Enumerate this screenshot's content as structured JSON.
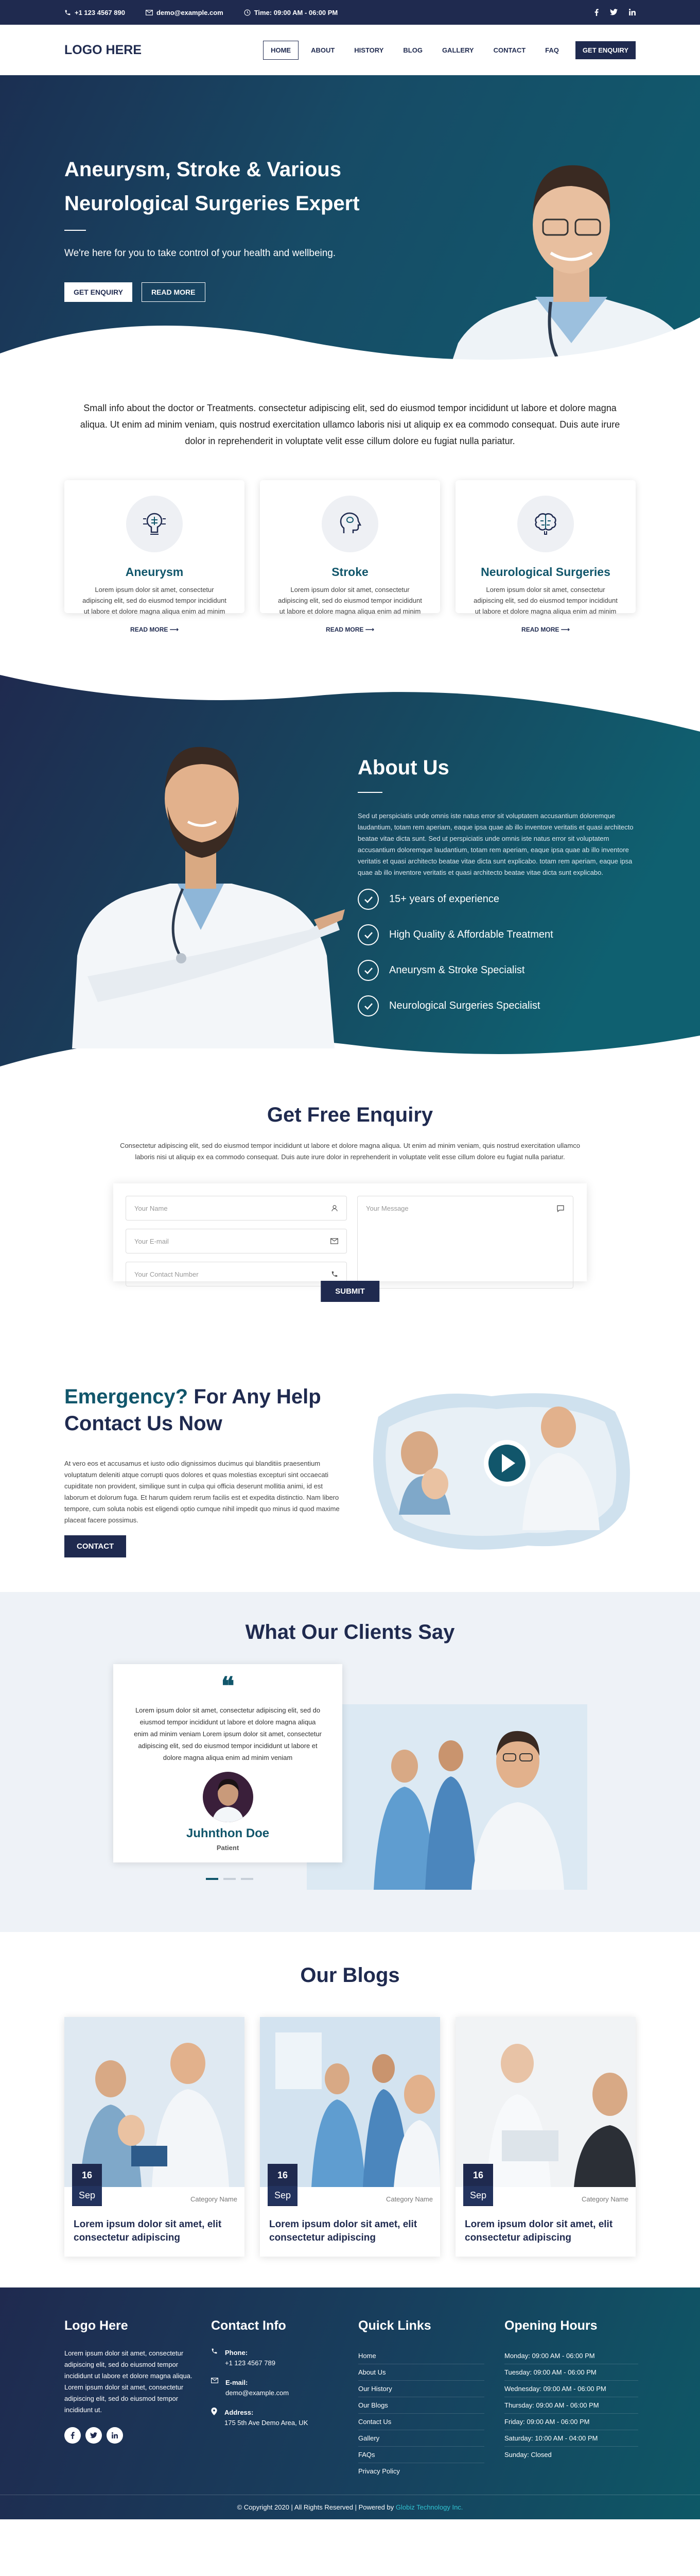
{
  "topbar": {
    "phone": "+1 123 4567 890",
    "email": "demo@example.com",
    "time": "Time: 09:00 AM - 06:00 PM"
  },
  "nav": {
    "logo": "LOGO HERE",
    "items": [
      "HOME",
      "ABOUT",
      "HISTORY",
      "BLOG",
      "GALLERY",
      "CONTACT",
      "FAQ"
    ],
    "cta": "GET ENQUIRY"
  },
  "hero": {
    "title": "Aneurysm, Stroke & Various Neurological Surgeries Expert",
    "subtitle": "We're here for you to take control of your health and wellbeing.",
    "btn_primary": "GET ENQUIRY",
    "btn_secondary": "READ MORE"
  },
  "intro": "Small info about the doctor or Treatments. consectetur adipiscing elit, sed do eiusmod tempor incididunt ut labore et dolore magna aliqua. Ut enim ad minim veniam, quis nostrud exercitation ullamco laboris nisi ut aliquip ex ea commodo consequat. Duis aute irure dolor in reprehenderit in voluptate velit esse cillum dolore eu fugiat nulla pariatur.",
  "services": [
    {
      "title": "Aneurysm",
      "desc": "Lorem ipsum dolor sit amet, consectetur adipiscing elit, sed do eiusmod tempor incididunt ut labore et dolore magna aliqua enim ad minim",
      "more": "READ MORE",
      "icon": "brain-circuit-icon"
    },
    {
      "title": "Stroke",
      "desc": "Lorem ipsum dolor sit amet, consectetur adipiscing elit, sed do eiusmod tempor incididunt ut labore et dolore magna aliqua enim ad minim",
      "more": "READ MORE",
      "icon": "head-brain-icon"
    },
    {
      "title": "Neurological Surgeries",
      "desc": "Lorem ipsum dolor sit amet, consectetur adipiscing elit, sed do eiusmod tempor incididunt ut labore et dolore magna aliqua enim ad minim",
      "more": "READ MORE",
      "icon": "brain-icon"
    }
  ],
  "about": {
    "title": "About Us",
    "text": "Sed ut perspiciatis unde omnis iste natus error sit voluptatem accusantium doloremque laudantium, totam rem aperiam, eaque ipsa quae ab illo inventore veritatis et quasi architecto beatae vitae dicta sunt. Sed ut perspiciatis unde omnis iste natus error sit voluptatem accusantium doloremque laudantium, totam rem aperiam, eaque ipsa quae ab illo inventore veritatis et quasi architecto beatae vitae dicta sunt explicabo. totam rem aperiam, eaque ipsa quae ab illo inventore veritatis et quasi architecto beatae vitae dicta sunt explicabo.",
    "points": [
      "15+ years of experience",
      "High Quality & Affordable Treatment",
      "Aneurysm & Stroke Specialist",
      "Neurological Surgeries Specialist"
    ]
  },
  "enquiry": {
    "title": "Get Free Enquiry",
    "text": "Consectetur adipiscing elit, sed do eiusmod tempor incididunt ut labore et dolore magna aliqua. Ut enim ad minim veniam, quis nostrud exercitation ullamco laboris nisi ut aliquip ex ea commodo consequat. Duis aute irure dolor in reprehenderit in voluptate velit esse cillum dolore eu fugiat nulla pariatur.",
    "name_placeholder": "Your Name",
    "email_placeholder": "Your E-mail",
    "phone_placeholder": "Your Contact Number",
    "message_placeholder": "Your Message",
    "submit": "SUBMIT"
  },
  "emergency": {
    "title_highlight": "Emergency?",
    "title_rest1": " For Any Help",
    "title_rest2": "Contact Us Now",
    "text": "At vero eos et accusamus et iusto odio dignissimos ducimus qui blanditiis praesentium voluptatum deleniti atque corrupti quos dolores et quas molestias excepturi sint occaecati cupiditate non provident, similique sunt in culpa qui officia deserunt mollitia animi, id est laborum et dolorum fuga. Et harum quidem rerum facilis est et expedita distinctio. Nam libero tempore, cum soluta nobis est eligendi optio cumque nihil impedit quo minus id quod maxime placeat facere possimus.",
    "button": "CONTACT"
  },
  "clients": {
    "title": "What Our Clients Say",
    "quote": "Lorem ipsum dolor sit amet, consectetur adipiscing elit, sed do eiusmod tempor incididunt ut labore et dolore magna aliqua enim ad minim veniam Lorem ipsum dolor sit amet, consectetur adipiscing elit, sed do eiusmod tempor incididunt ut labore et dolore magna aliqua enim ad minim veniam",
    "name": "Juhnthon Doe",
    "role": "Patient"
  },
  "blogs": {
    "title": "Our Blogs",
    "posts": [
      {
        "day": "16",
        "month": "Sep",
        "category": "Category Name",
        "title": "Lorem ipsum dolor sit amet, elit consectetur adipiscing"
      },
      {
        "day": "16",
        "month": "Sep",
        "category": "Category Name",
        "title": "Lorem ipsum dolor sit amet, elit consectetur adipiscing"
      },
      {
        "day": "16",
        "month": "Sep",
        "category": "Category Name",
        "title": "Lorem ipsum dolor sit amet, elit consectetur adipiscing"
      }
    ]
  },
  "footer": {
    "logo": "Logo Here",
    "about": "Lorem ipsum dolor sit amet, consectetur adipiscing elit, sed do eiusmod tempor incididunt ut labore et dolore magna aliqua. Lorem ipsum dolor sit amet, consectetur adipiscing elit, sed do eiusmod tempor incididunt ut.",
    "contact_title": "Contact Info",
    "phone_label": "Phone:",
    "phone": "+1 123 4567 789",
    "email_label": "E-mail:",
    "email": "demo@example.com",
    "address_label": "Address:",
    "address": "175 5th Ave Demo Area, UK",
    "links_title": "Quick Links",
    "links": [
      "Home",
      "About Us",
      "Our History",
      "Our Blogs",
      "Contact Us",
      "Gallery",
      "FAQs",
      "Privacy Policy"
    ],
    "hours_title": "Opening Hours",
    "hours": [
      "Monday: 09:00 AM - 06:00 PM",
      "Tuesday: 09:00 AM - 06:00 PM",
      "Wednesday: 09:00 AM - 06:00 PM",
      "Thursday: 09:00 AM - 06:00 PM",
      "Friday: 09:00 AM - 06:00 PM",
      "Saturday: 10:00 AM - 04:00 PM",
      "Sunday: Closed"
    ],
    "copyright": "© Copyright 2020  |  All Rights Reserved  |  Powered by",
    "powered_by": "Globiz Technology Inc."
  },
  "colors": {
    "navy": "#1f2a4f",
    "teal": "#11566b",
    "accent": "#31c2d0"
  }
}
